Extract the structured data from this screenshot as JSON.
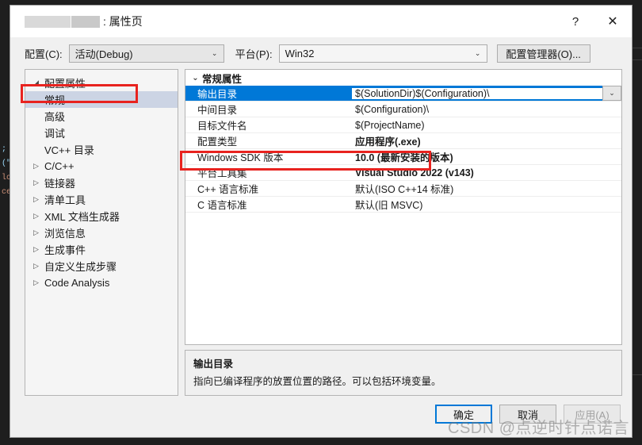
{
  "window": {
    "title_redacted": true,
    "title_suffix": ": 属性页",
    "help_glyph": "?",
    "close_glyph": "✕"
  },
  "configbar": {
    "config_label": "配置(C):",
    "config_value": "活动(Debug)",
    "platform_label": "平台(P):",
    "platform_value": "Win32",
    "config_manager_label": "配置管理器(O)...",
    "chevron": "⌄"
  },
  "tree": {
    "root": {
      "label": "配置属性",
      "arrow": "◢"
    },
    "items": [
      {
        "label": "常规",
        "arrow": "",
        "selected": true,
        "indent": true
      },
      {
        "label": "高级",
        "arrow": "",
        "selected": false,
        "indent": true
      },
      {
        "label": "调试",
        "arrow": "",
        "selected": false,
        "indent": true
      },
      {
        "label": "VC++ 目录",
        "arrow": "",
        "selected": false,
        "indent": true
      },
      {
        "label": "C/C++",
        "arrow": "▷",
        "selected": false,
        "indent": false
      },
      {
        "label": "链接器",
        "arrow": "▷",
        "selected": false,
        "indent": false
      },
      {
        "label": "清单工具",
        "arrow": "▷",
        "selected": false,
        "indent": false
      },
      {
        "label": "XML 文档生成器",
        "arrow": "▷",
        "selected": false,
        "indent": false
      },
      {
        "label": "浏览信息",
        "arrow": "▷",
        "selected": false,
        "indent": false
      },
      {
        "label": "生成事件",
        "arrow": "▷",
        "selected": false,
        "indent": false
      },
      {
        "label": "自定义生成步骤",
        "arrow": "▷",
        "selected": false,
        "indent": false
      },
      {
        "label": "Code Analysis",
        "arrow": "▷",
        "selected": false,
        "indent": false
      }
    ]
  },
  "grid": {
    "group_header": "常规属性",
    "group_chevron": "⌄",
    "value_chevron": "⌄",
    "rows": [
      {
        "name": "输出目录",
        "value": "$(SolutionDir)$(Configuration)\\",
        "selected": true,
        "bold": false,
        "dropdown": true
      },
      {
        "name": "中间目录",
        "value": "$(Configuration)\\",
        "selected": false,
        "bold": false,
        "dropdown": false
      },
      {
        "name": "目标文件名",
        "value": "$(ProjectName)",
        "selected": false,
        "bold": false,
        "dropdown": false
      },
      {
        "name": "配置类型",
        "value": "应用程序(.exe)",
        "selected": false,
        "bold": true,
        "dropdown": false
      },
      {
        "name": "Windows SDK 版本",
        "value": "10.0 (最新安装的版本)",
        "selected": false,
        "bold": true,
        "dropdown": false
      },
      {
        "name": "平台工具集",
        "value": "Visual Studio 2022 (v143)",
        "selected": false,
        "bold": true,
        "dropdown": false
      },
      {
        "name": "C++ 语言标准",
        "value": "默认(ISO C++14 标准)",
        "selected": false,
        "bold": false,
        "dropdown": false
      },
      {
        "name": "C 语言标准",
        "value": "默认(旧 MSVC)",
        "selected": false,
        "bold": false,
        "dropdown": false
      }
    ]
  },
  "description": {
    "title": "输出目录",
    "text": "指向已编译程序的放置位置的路径。可以包括环境变量。"
  },
  "footer": {
    "ok_label": "确定",
    "cancel_label": "取消",
    "apply_label": "应用(A)",
    "apply_disabled": true
  },
  "annotations": {
    "color": "#e8231f",
    "boxes": [
      "tree-item-general",
      "property-row-configuration-type"
    ]
  },
  "watermark": {
    "text": "CSDN @点逆时针点诺言"
  },
  "backdrop": {
    "code_lines": [
      ";",
      "(\"",
      "lc",
      "ce"
    ]
  }
}
